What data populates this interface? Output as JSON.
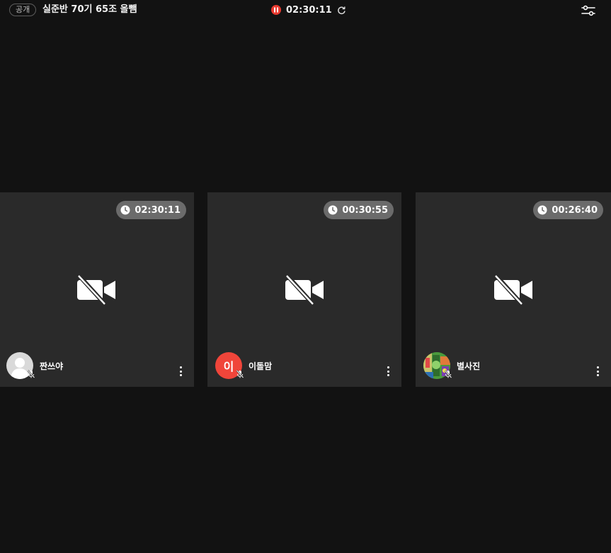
{
  "header": {
    "visibility_badge": "공개",
    "room_title": "실준반 70기 65조 올뺌",
    "timer": "02:30:11",
    "colors": {
      "pause": "#e8392f",
      "background": "#121212"
    },
    "icons": {
      "pause": "pause-icon",
      "refresh": "refresh-icon",
      "settings": "sliders-icon"
    }
  },
  "participants": [
    {
      "name": "짠쓰야",
      "study_time": "02:30:11",
      "avatar_type": "default-profile",
      "avatar_color": "#d9d9d9",
      "camera": "off",
      "mic": "off"
    },
    {
      "name": "이돌맘",
      "study_time": "00:30:55",
      "avatar_type": "letter",
      "avatar_letter": "이",
      "avatar_color": "#f0453a",
      "camera": "off",
      "mic": "off"
    },
    {
      "name": "별사진",
      "study_time": "00:26:40",
      "avatar_type": "photo",
      "avatar_color": "#3b8c3a",
      "camera": "off",
      "mic": "off"
    }
  ]
}
